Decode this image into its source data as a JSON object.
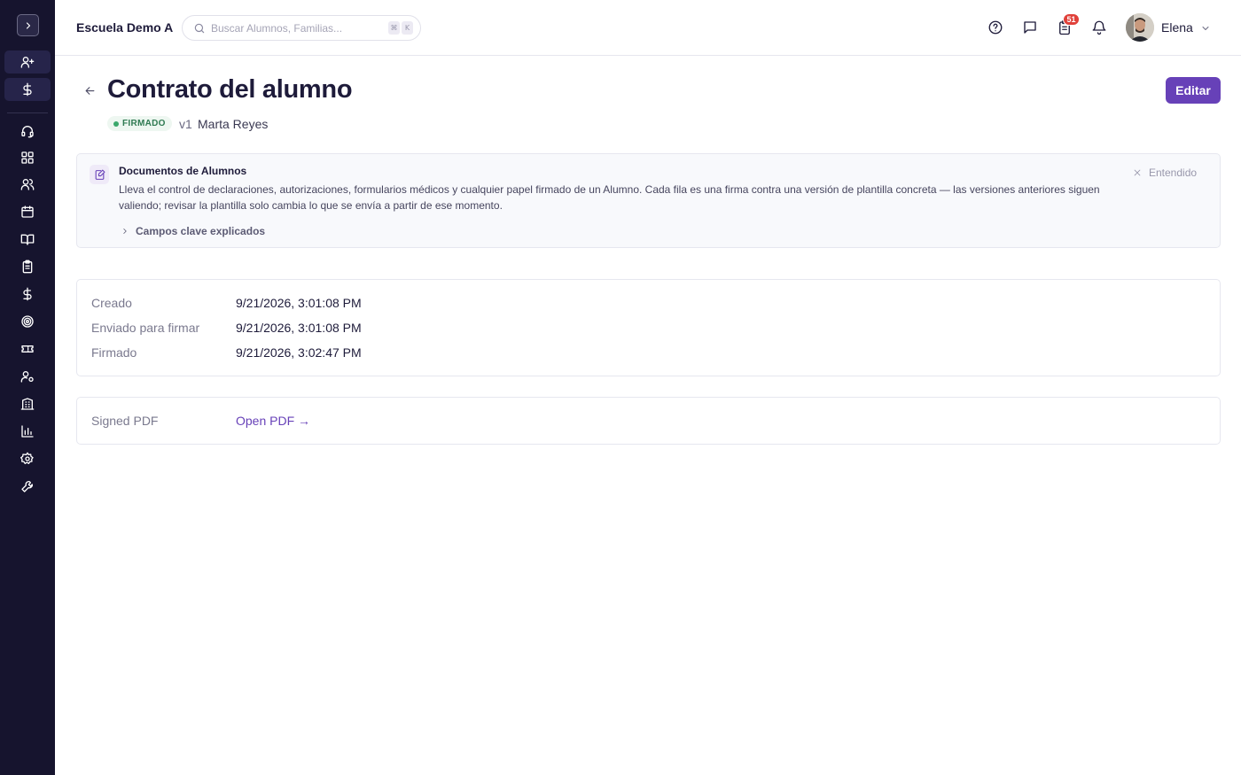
{
  "sidebar": {
    "toggle_icon": "chevron-right-icon",
    "items": [
      {
        "icon": "user-plus-icon",
        "highlighted": true
      },
      {
        "icon": "dollar-icon",
        "highlighted": true
      },
      {
        "icon": "headset-icon"
      },
      {
        "icon": "dashboard-icon"
      },
      {
        "icon": "users-icon"
      },
      {
        "icon": "calendar-icon"
      },
      {
        "icon": "book-open-icon"
      },
      {
        "icon": "clipboard-icon"
      },
      {
        "icon": "dollar-icon"
      },
      {
        "icon": "target-icon"
      },
      {
        "icon": "ticket-icon"
      },
      {
        "icon": "user-cog-icon"
      },
      {
        "icon": "building-icon"
      },
      {
        "icon": "bar-chart-icon"
      },
      {
        "icon": "gear-icon"
      },
      {
        "icon": "wrench-icon"
      }
    ]
  },
  "header": {
    "school_name": "Escuela Demo A",
    "search": {
      "placeholder": "Buscar Alumnos, Familias...",
      "value": "",
      "shortcut": [
        "⌘",
        "K"
      ]
    },
    "notifications_badge": "51",
    "user": {
      "name": "Elena"
    }
  },
  "page": {
    "title": "Contrato del alumno",
    "status": "FIRMADO",
    "version": "v1",
    "student": "Marta Reyes",
    "edit_label": "Editar"
  },
  "info_panel": {
    "title": "Documentos de Alumnos",
    "body": "Lleva el control de declaraciones, autorizaciones, formularios médicos y cualquier papel firmado de un Alumno. Cada fila es una firma contra una versión de plantilla concreta — las versiones anteriores siguen valiendo; revisar la plantilla solo cambia lo que se envía a partir de ese momento.",
    "dismiss_label": "Entendido",
    "expand_label": "Campos clave explicados"
  },
  "details": [
    {
      "label": "Creado",
      "value": "9/21/2026, 3:01:08 PM"
    },
    {
      "label": "Enviado para firmar",
      "value": "9/21/2026, 3:01:08 PM"
    },
    {
      "label": "Firmado",
      "value": "9/21/2026, 3:02:47 PM"
    }
  ],
  "pdf": {
    "label": "Signed PDF",
    "link": "Open PDF →"
  },
  "colors": {
    "sidebar_bg": "#16142e",
    "accent": "#6741b8",
    "status_green": "#2f7a52",
    "badge_red": "#e0413a"
  }
}
